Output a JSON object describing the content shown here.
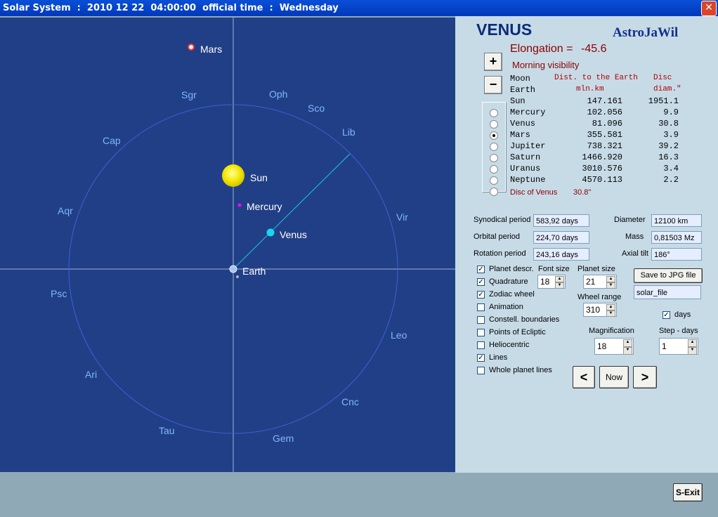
{
  "window": {
    "title": "Solar System  :  2010 12 22  04:00:00  official time  :  Wednesday",
    "close_glyph": "✕"
  },
  "sky": {
    "zodiac": [
      "Sgr",
      "Oph",
      "Sco",
      "Lib",
      "Vir",
      "Leo",
      "Cnc",
      "Gem",
      "Tau",
      "Ari",
      "Psc",
      "Aqr",
      "Cap"
    ],
    "bodies": {
      "mars": "Mars",
      "sun": "Sun",
      "mercury": "Mercury",
      "venus": "Venus",
      "earth": "Earth"
    },
    "colors": {
      "background": "#213f86",
      "sun": "#f3e600",
      "venus": "#19d6f0",
      "mercury": "#ff00ff",
      "mars": "#ff3030"
    }
  },
  "panel": {
    "planet": "VENUS",
    "brand": "AstroJaWil",
    "elongation_label": "Elongation =",
    "elongation_value": "-45.6",
    "visibility": "Morning visibility",
    "zoom_in": "+",
    "zoom_out": "−",
    "table": {
      "header_col1": "Dist. to the Earth",
      "header_col1b": "mln.km",
      "header_col2": "Disc",
      "header_col2b": "diam.\"",
      "rows": [
        {
          "name": "Moon",
          "dist": "",
          "disc": ""
        },
        {
          "name": "Earth",
          "dist": "",
          "disc": ""
        },
        {
          "name": "Sun",
          "dist": "147.161",
          "disc": "1951.1"
        },
        {
          "name": "Mercury",
          "dist": "102.056",
          "disc": "9.9"
        },
        {
          "name": "Venus",
          "dist": "81.096",
          "disc": "30.8"
        },
        {
          "name": "Mars",
          "dist": "355.581",
          "disc": "3.9"
        },
        {
          "name": "Jupiter",
          "dist": "738.321",
          "disc": "39.2"
        },
        {
          "name": "Saturn",
          "dist": "1466.920",
          "disc": "16.3"
        },
        {
          "name": "Uranus",
          "dist": "3010.576",
          "disc": "3.4"
        },
        {
          "name": "Neptune",
          "dist": "4570.113",
          "disc": "2.2"
        }
      ],
      "selected": "Venus"
    },
    "disc_label": "Disc of Venus",
    "disc_value": "30.8\"",
    "props": {
      "synodical_label": "Synodical period",
      "synodical_value": "583,92 days",
      "orbital_label": "Orbital period",
      "orbital_value": "224,70 days",
      "rotation_label": "Rotation period",
      "rotation_value": "243,16 days",
      "diameter_label": "Diameter",
      "diameter_value": "12100 km",
      "mass_label": "Mass",
      "mass_value": "0,81503 Mz",
      "tilt_label": "Axial tilt",
      "tilt_value": "186°"
    },
    "options": [
      {
        "label": "Planet descr.",
        "checked": true
      },
      {
        "label": "Quadrature",
        "checked": true
      },
      {
        "label": "Zodiac wheel",
        "checked": true
      },
      {
        "label": "Animation",
        "checked": false
      },
      {
        "label": "Constell. boundaries",
        "checked": false
      },
      {
        "label": "Points of Ecliptic",
        "checked": false
      },
      {
        "label": "Heliocentric",
        "checked": false
      },
      {
        "label": "Lines",
        "checked": true
      },
      {
        "label": "Whole planet lines",
        "checked": false
      }
    ],
    "font_size_label": "Font size",
    "font_size": "18",
    "planet_size_label": "Planet size",
    "planet_size": "21",
    "wheel_range_label": "Wheel range",
    "wheel_range": "310",
    "save_jpg": "Save to JPG file",
    "filename": "solar_file",
    "days_label": "days",
    "days_checked": true,
    "magnification_label": "Magnification",
    "magnification": "18",
    "step_label": "Step - days",
    "step": "1",
    "prev": "<",
    "now": "Now",
    "next": ">",
    "exit": "S-Exit"
  }
}
